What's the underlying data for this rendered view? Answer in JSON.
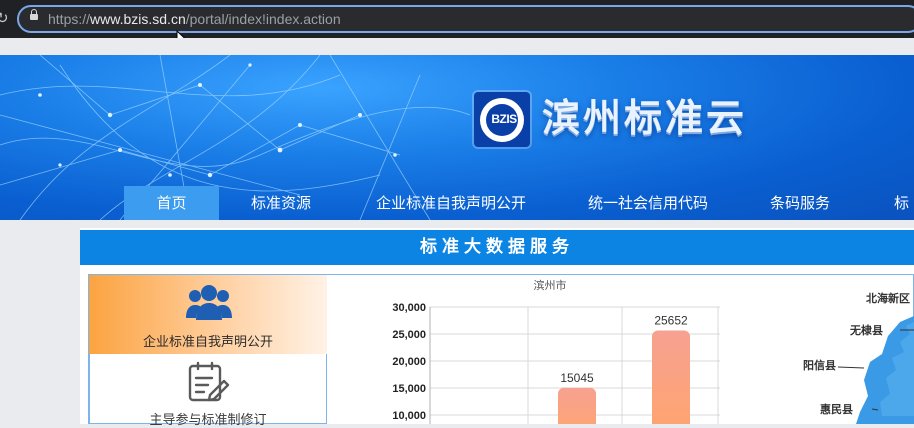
{
  "browser": {
    "url_prefix": "https://",
    "url_host": "www.bzis.sd.cn",
    "url_path": "/portal/index!index.action"
  },
  "banner": {
    "logo_text": "BZIS",
    "site_title": "滨州标准云"
  },
  "nav": {
    "items": [
      "首页",
      "标准资源",
      "企业标准自我声明公开",
      "统一社会信用代码",
      "条码服务",
      "标"
    ],
    "active_index": 0
  },
  "section": {
    "title": "标准大数据服务"
  },
  "menu": {
    "items": [
      {
        "label": "企业标准自我声明公开",
        "icon": "users-icon",
        "active": true
      },
      {
        "label": "主导参与标准制修订",
        "icon": "document-edit-icon",
        "active": false
      }
    ]
  },
  "chart_data": {
    "type": "bar",
    "title": "滨州市",
    "yticks": [
      "30,000",
      "25,000",
      "20,000",
      "15,000",
      "10,000"
    ],
    "ylim": [
      10000,
      30000
    ],
    "bars": [
      {
        "value": 15045,
        "label": "15045"
      },
      {
        "value": 25652,
        "label": "25652"
      }
    ],
    "grid": true,
    "bar_color_top": "#f6a08f",
    "bar_color_bottom": "#ffa06a"
  },
  "map": {
    "labels": [
      "北海新区",
      "无棣县",
      "阳信县",
      "惠民县"
    ],
    "color": "#3a9ae6"
  },
  "colors": {
    "accent": "#0c84e4",
    "nav_active": "#3b9cf0",
    "banner": "#1b7fe8"
  }
}
